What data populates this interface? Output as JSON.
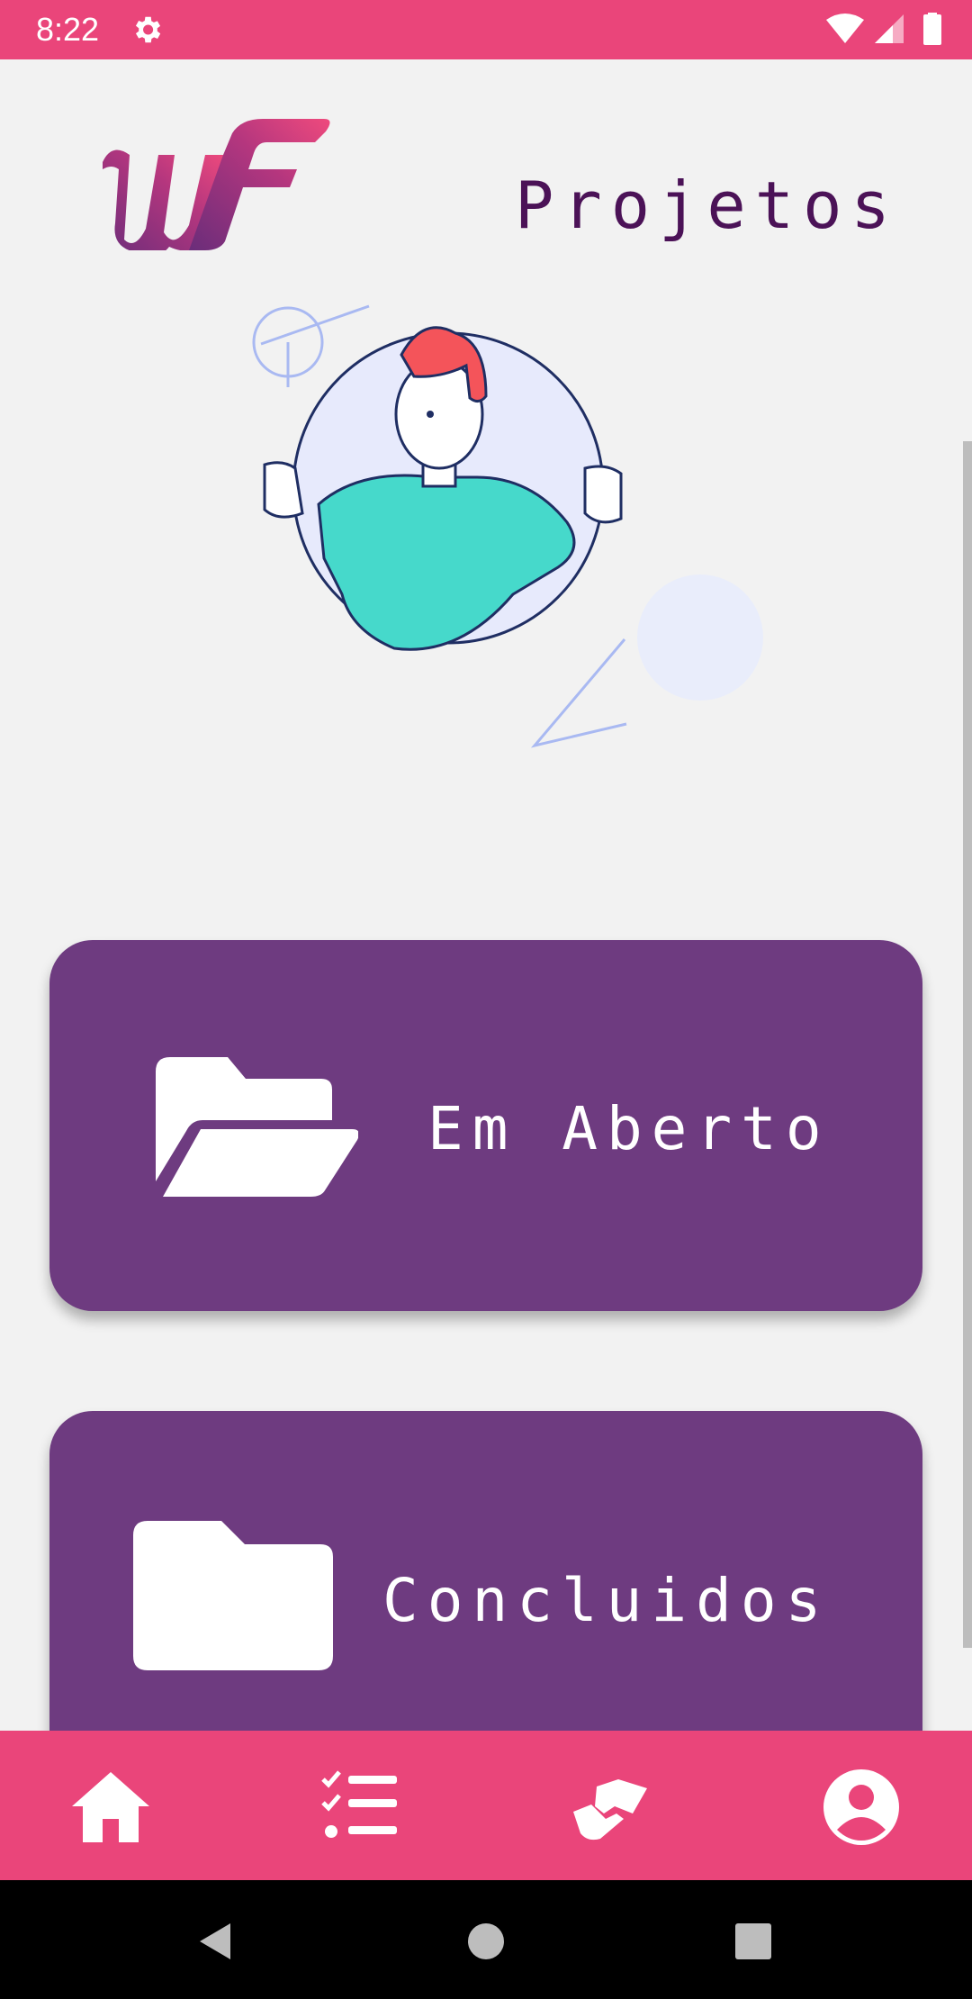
{
  "status_bar": {
    "time": "8:22",
    "icons": [
      "gear-icon",
      "wifi-icon",
      "signal-icon",
      "battery-icon"
    ]
  },
  "header": {
    "title": "Projetos",
    "logo": "wf-logo"
  },
  "cards": [
    {
      "label": "Em Aberto",
      "icon": "folder-open-icon"
    },
    {
      "label": "Concluidos",
      "icon": "folder-icon"
    }
  ],
  "bottom_nav": {
    "items": [
      "home-icon",
      "tasks-list-icon",
      "handshake-icon",
      "profile-icon"
    ]
  },
  "colors": {
    "primary": "#ea457a",
    "card": "#6e3b80",
    "title": "#4b1257",
    "background": "#f2f2f2"
  }
}
